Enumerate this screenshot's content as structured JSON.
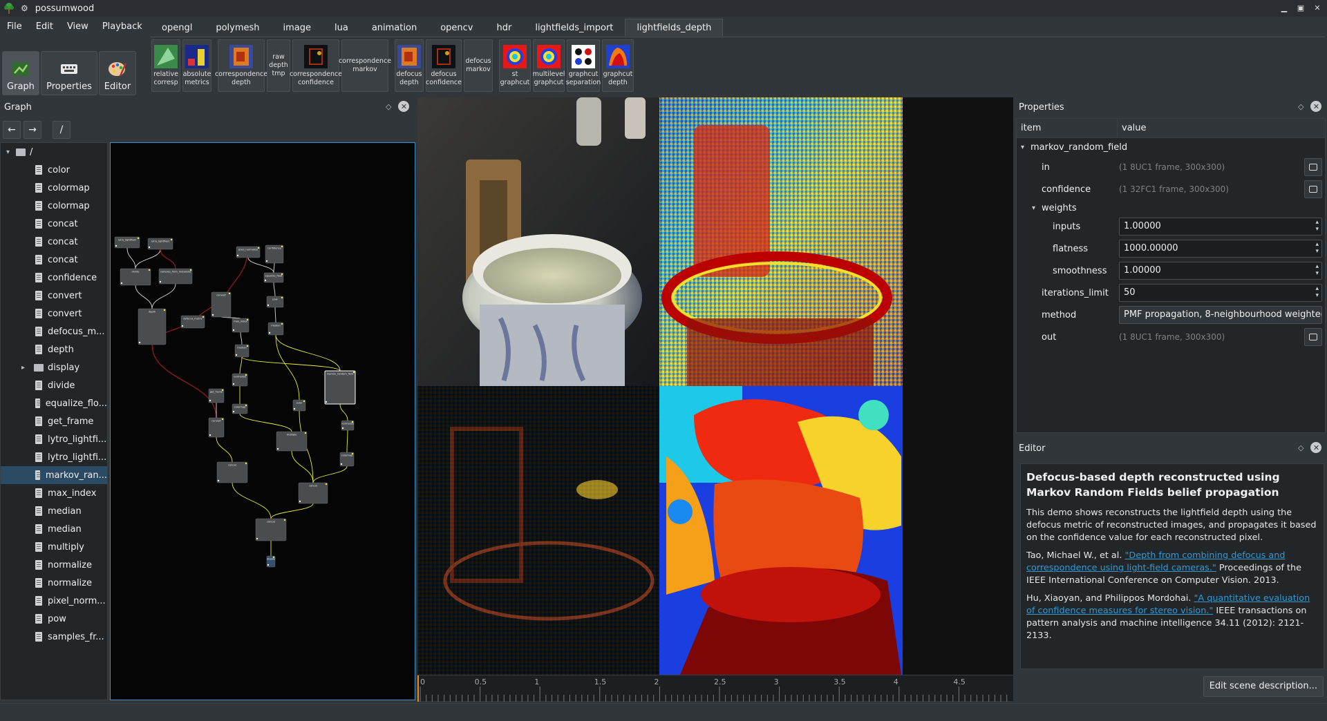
{
  "window": {
    "title": "possumwood"
  },
  "menu": [
    "File",
    "Edit",
    "View",
    "Playback"
  ],
  "main_buttons": [
    {
      "label": "Graph",
      "icon": "graph-icon"
    },
    {
      "label": "Properties",
      "icon": "keyboard-icon"
    },
    {
      "label": "Editor",
      "icon": "palette-icon"
    }
  ],
  "tabs": [
    "opengl",
    "polymesh",
    "image",
    "lua",
    "animation",
    "opencv",
    "hdr",
    "lightfields_import",
    "lightfields_depth"
  ],
  "active_tab": "lightfields_depth",
  "tools": [
    {
      "label": "relative\ncorresp",
      "thumb": "green"
    },
    {
      "label": "absolute\nmetrics",
      "thumb": "blue"
    },
    {
      "label": "correspondence\ndepth",
      "thumb": "orange"
    },
    {
      "label": "raw\ndepth\ntmp",
      "thumb": ""
    },
    {
      "label": "correspondence\nconfidence",
      "thumb": "dark"
    },
    {
      "label": "correspondence\nmarkov",
      "thumb": ""
    },
    {
      "label": "defocus\ndepth",
      "thumb": "orange"
    },
    {
      "label": "defocus\nconfidence",
      "thumb": "dark"
    },
    {
      "label": "defocus\nmarkov",
      "thumb": ""
    },
    {
      "label": "st\ngraphcut",
      "thumb": "ring"
    },
    {
      "label": "multilevel\ngraphcut",
      "thumb": "ring"
    },
    {
      "label": "graphcut\nseparation",
      "thumb": "dots"
    },
    {
      "label": "graphcut\ndepth",
      "thumb": "fire"
    }
  ],
  "graph_panel": {
    "title": "Graph",
    "path": "/",
    "root": "/",
    "tree": [
      "color",
      "colormap",
      "colormap",
      "concat",
      "concat",
      "concat",
      "confidence",
      "convert",
      "convert",
      "defocus_m...",
      "depth",
      "display",
      "divide",
      "equalize_flo...",
      "get_frame",
      "lytro_lightfi...",
      "lytro_lightfi...",
      "markov_ran...",
      "max_index",
      "median",
      "median",
      "multiply",
      "normalize",
      "normalize",
      "pixel_norm...",
      "pow",
      "samples_fr..."
    ],
    "selected": "markov_ran..."
  },
  "graph_nodes": [
    "lytro_lightfield",
    "lytro_lightfield",
    "divide",
    "samples_from_metadata",
    "depth",
    "defocus_metric",
    "convert",
    "pixel_normalize",
    "confidence",
    "equalize_float",
    "pow",
    "max_index",
    "median",
    "median",
    "normalize",
    "markov_random_field",
    "get_frame",
    "colormap",
    "color",
    "convert",
    "multiply",
    "normalize",
    "colormap",
    "concat",
    "concat",
    "concat",
    "display"
  ],
  "timeline": {
    "ticks": [
      "0",
      "0.5",
      "1",
      "1.5",
      "2",
      "2.5",
      "3",
      "3.5",
      "4",
      "4.5"
    ]
  },
  "properties": {
    "title": "Properties",
    "col_item": "item",
    "col_value": "value",
    "node": "markov_random_field",
    "in_label": "in",
    "in_value": "(1 8UC1 frame, 300x300)",
    "confidence_label": "confidence",
    "confidence_value": "(1 32FC1 frame, 300x300)",
    "weights_label": "weights",
    "inputs_label": "inputs",
    "inputs_value": "1.00000",
    "flatness_label": "flatness",
    "flatness_value": "1000.00000",
    "smoothness_label": "smoothness",
    "smoothness_value": "1.00000",
    "iterations_label": "iterations_limit",
    "iterations_value": "50",
    "method_label": "method",
    "method_value": "PMF propagation, 8-neighbourhood weighted",
    "out_label": "out",
    "out_value": "(1 8UC1 frame, 300x300)"
  },
  "editor": {
    "title": "Editor",
    "heading": "Defocus-based depth reconstructed using Markov Random Fields belief propagation",
    "para1": "This demo shows reconstructs the lightfield depth using the defocus metric of reconstructed images, and propagates it based on the confidence value for each reconstructed pixel.",
    "ref1_author": "Tao, Michael W., et al. ",
    "ref1_link": "\"Depth from combining defocus and correspondence using light-field cameras.\"",
    "ref1_rest": " Proceedings of the IEEE International Conference on Computer Vision. 2013.",
    "ref2_author": "Hu, Xiaoyan, and Philippos Mordohai. ",
    "ref2_link": "\"A quantitative evaluation of confidence measures for stereo vision.\"",
    "ref2_rest": " IEEE transactions on pattern analysis and machine intelligence 34.11 (2012): 2121-2133.",
    "button": "Edit scene description..."
  },
  "colors": {
    "accent": "#3daee9",
    "bg": "#31363b",
    "view_bg": "#232629",
    "link": "#2e9ad6"
  }
}
